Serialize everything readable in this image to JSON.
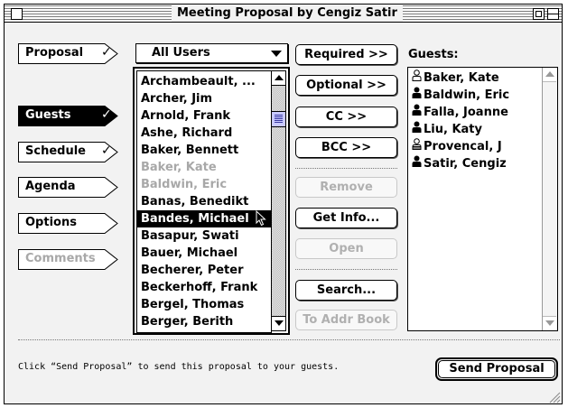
{
  "window": {
    "title": "Meeting Proposal by Cengiz Satir"
  },
  "tabs": [
    {
      "label": "Proposal",
      "checked": true,
      "selected": false,
      "disabled": false
    },
    {
      "label": "Guests",
      "checked": true,
      "selected": true,
      "disabled": false
    },
    {
      "label": "Schedule",
      "checked": true,
      "selected": false,
      "disabled": false
    },
    {
      "label": "Agenda",
      "checked": false,
      "selected": false,
      "disabled": false
    },
    {
      "label": "Options",
      "checked": false,
      "selected": false,
      "disabled": false
    },
    {
      "label": "Comments",
      "checked": false,
      "selected": false,
      "disabled": true
    }
  ],
  "check_glyph": "✓",
  "directory": {
    "filter_selected": "All Users",
    "people": [
      {
        "name": "Archambeault, ...",
        "state": "normal"
      },
      {
        "name": "Archer, Jim",
        "state": "normal"
      },
      {
        "name": "Arnold, Frank",
        "state": "normal"
      },
      {
        "name": "Ashe, Richard",
        "state": "normal"
      },
      {
        "name": "Baker, Bennett",
        "state": "normal"
      },
      {
        "name": "Baker, Kate",
        "state": "disabled"
      },
      {
        "name": "Baldwin, Eric",
        "state": "disabled"
      },
      {
        "name": "Banas, Benedikt",
        "state": "normal"
      },
      {
        "name": "Bandes, Michael",
        "state": "selected"
      },
      {
        "name": "Basapur, Swati",
        "state": "normal"
      },
      {
        "name": "Bauer, Michael",
        "state": "normal"
      },
      {
        "name": "Becherer, Peter",
        "state": "normal"
      },
      {
        "name": "Beckerhoff, Frank",
        "state": "normal"
      },
      {
        "name": "Bergel, Thomas",
        "state": "normal"
      },
      {
        "name": "Berger, Berith",
        "state": "normal"
      }
    ]
  },
  "actions": {
    "required": "Required >>",
    "optional": "Optional >>",
    "cc": "CC >>",
    "bcc": "BCC >>",
    "remove": "Remove",
    "get_info": "Get Info...",
    "open": "Open",
    "search": "Search...",
    "to_addr_book": "To Addr Book"
  },
  "guests": {
    "label": "Guests:",
    "items": [
      {
        "name": "Baker, Kate",
        "icon": "person-outline-icon"
      },
      {
        "name": "Baldwin, Eric",
        "icon": "person-filled-icon"
      },
      {
        "name": "Falla, Joanne",
        "icon": "person-filled-icon"
      },
      {
        "name": "Liu, Katy",
        "icon": "person-filled-icon"
      },
      {
        "name": "Provencal, J",
        "icon": "person-striped-icon"
      },
      {
        "name": "Satir, Cengiz",
        "icon": "person-filled-icon"
      }
    ]
  },
  "footer": {
    "hint": "Click “Send Proposal” to send this proposal to your guests.",
    "send_label": "Send Proposal"
  }
}
